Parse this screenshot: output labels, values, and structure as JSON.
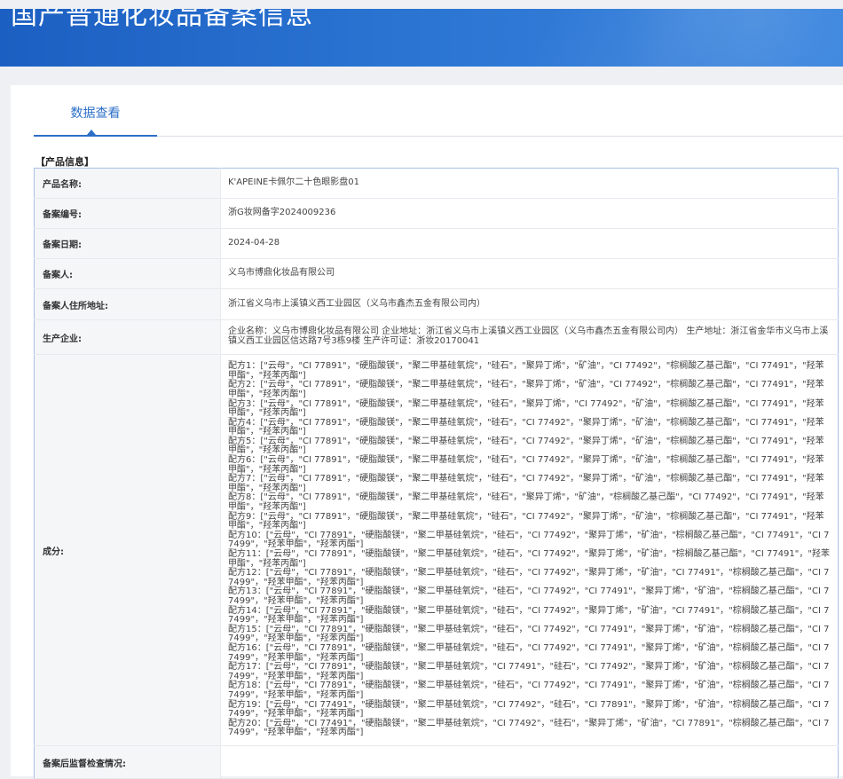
{
  "header": {
    "title": "国产普通化妆品备案信息"
  },
  "tabs": [
    {
      "label": "数据查看"
    }
  ],
  "section_title": "【产品信息】",
  "rows": {
    "product_name": {
      "label": "产品名称:",
      "value": "K'APEINE卡佩尔二十色眼影盘01"
    },
    "record_no": {
      "label": "备案编号:",
      "value": "浙G妆网备字2024009236"
    },
    "record_date": {
      "label": "备案日期:",
      "value": "2024-04-28"
    },
    "registrant": {
      "label": "备案人:",
      "value": "义乌市博鼎化妆品有限公司"
    },
    "registrant_address": {
      "label": "备案人住所地址:",
      "value": "浙江省义乌市上溪镇义西工业园区（义乌市鑫杰五金有限公司内）"
    },
    "manufacturer": {
      "label": "生产企业:",
      "value": "企业名称：义乌市博鼎化妆品有限公司 企业地址：浙江省义乌市上溪镇义西工业园区（义乌市鑫杰五金有限公司内） 生产地址：浙江省金华市义乌市上溪镇义西工业园区信达路7号3栋9楼 生产许可证：浙妆20170041"
    },
    "ingredients": {
      "label": "成分:",
      "formulas": [
        "配方1：[\"云母\"，\"CI 77891\"，\"硬脂酸镁\"，\"聚二甲基硅氧烷\"，\"硅石\"，\"聚异丁烯\"，\"矿油\"，\"CI 77492\"，\"棕榈酸乙基己酯\"，\"CI 77491\"，\"羟苯甲酯\"，\"羟苯丙酯\"]",
        "配方2：[\"云母\"，\"CI 77891\"，\"硬脂酸镁\"，\"聚二甲基硅氧烷\"，\"硅石\"，\"聚异丁烯\"，\"矿油\"，\"CI 77492\"，\"棕榈酸乙基己酯\"，\"CI 77491\"，\"羟苯甲酯\"，\"羟苯丙酯\"]",
        "配方3：[\"云母\"，\"CI 77891\"，\"硬脂酸镁\"，\"聚二甲基硅氧烷\"，\"硅石\"，\"聚异丁烯\"，\"CI 77492\"，\"矿油\"，\"棕榈酸乙基己酯\"，\"CI 77491\"，\"羟苯甲酯\"，\"羟苯丙酯\"]",
        "配方4：[\"云母\"，\"CI 77891\"，\"硬脂酸镁\"，\"聚二甲基硅氧烷\"，\"硅石\"，\"CI 77492\"，\"聚异丁烯\"，\"矿油\"，\"棕榈酸乙基己酯\"，\"CI 77491\"，\"羟苯甲酯\"，\"羟苯丙酯\"]",
        "配方5：[\"云母\"，\"CI 77891\"，\"硬脂酸镁\"，\"聚二甲基硅氧烷\"，\"硅石\"，\"CI 77492\"，\"聚异丁烯\"，\"矿油\"，\"棕榈酸乙基己酯\"，\"CI 77491\"，\"羟苯甲酯\"，\"羟苯丙酯\"]",
        "配方6：[\"云母\"，\"CI 77891\"，\"硬脂酸镁\"，\"聚二甲基硅氧烷\"，\"硅石\"，\"CI 77492\"，\"聚异丁烯\"，\"矿油\"，\"棕榈酸乙基己酯\"，\"CI 77491\"，\"羟苯甲酯\"，\"羟苯丙酯\"]",
        "配方7：[\"云母\"，\"CI 77891\"，\"硬脂酸镁\"，\"聚二甲基硅氧烷\"，\"硅石\"，\"CI 77492\"，\"聚异丁烯\"，\"矿油\"，\"棕榈酸乙基己酯\"，\"CI 77491\"，\"羟苯甲酯\"，\"羟苯丙酯\"]",
        "配方8：[\"云母\"，\"CI 77891\"，\"硬脂酸镁\"，\"聚二甲基硅氧烷\"，\"硅石\"，\"聚异丁烯\"，\"矿油\"，\"棕榈酸乙基己酯\"，\"CI 77492\"，\"CI 77491\"，\"羟苯甲酯\"，\"羟苯丙酯\"]",
        "配方9：[\"云母\"，\"CI 77891\"，\"硬脂酸镁\"，\"聚二甲基硅氧烷\"，\"硅石\"，\"CI 77492\"，\"聚异丁烯\"，\"矿油\"，\"棕榈酸乙基己酯\"，\"CI 77491\"，\"羟苯甲酯\"，\"羟苯丙酯\"]",
        "配方10：[\"云母\"，\"CI 77891\"，\"硬脂酸镁\"，\"聚二甲基硅氧烷\"，\"硅石\"，\"CI 77492\"，\"聚异丁烯\"，\"矿油\"，\"棕榈酸乙基己酯\"，\"CI 77491\"，\"CI 77499\"，\"羟苯甲酯\"，\"羟苯丙酯\"]",
        "配方11：[\"云母\"，\"CI 77891\"，\"硬脂酸镁\"，\"聚二甲基硅氧烷\"，\"硅石\"，\"CI 77492\"，\"聚异丁烯\"，\"矿油\"，\"棕榈酸乙基己酯\"，\"CI 77491\"，\"羟苯甲酯\"，\"羟苯丙酯\"]",
        "配方12：[\"云母\"，\"CI 77891\"，\"硬脂酸镁\"，\"聚二甲基硅氧烷\"，\"硅石\"，\"CI 77492\"，\"聚异丁烯\"，\"矿油\"，\"CI 77491\"，\"棕榈酸乙基己酯\"，\"CI 77499\"，\"羟苯甲酯\"，\"羟苯丙酯\"]",
        "配方13：[\"云母\"，\"CI 77891\"，\"硬脂酸镁\"，\"聚二甲基硅氧烷\"，\"硅石\"，\"CI 77492\"，\"CI 77491\"，\"聚异丁烯\"，\"矿油\"，\"棕榈酸乙基己酯\"，\"CI 77499\"，\"羟苯甲酯\"，\"羟苯丙酯\"]",
        "配方14：[\"云母\"，\"CI 77891\"，\"硬脂酸镁\"，\"聚二甲基硅氧烷\"，\"硅石\"，\"CI 77492\"，\"聚异丁烯\"，\"矿油\"，\"CI 77491\"，\"棕榈酸乙基己酯\"，\"CI 77499\"，\"羟苯甲酯\"，\"羟苯丙酯\"]",
        "配方15：[\"云母\"，\"CI 77891\"，\"硬脂酸镁\"，\"聚二甲基硅氧烷\"，\"硅石\"，\"CI 77492\"，\"CI 77491\"，\"聚异丁烯\"，\"矿油\"，\"棕榈酸乙基己酯\"，\"CI 77499\"，\"羟苯甲酯\"，\"羟苯丙酯\"]",
        "配方16：[\"云母\"，\"CI 77891\"，\"硬脂酸镁\"，\"聚二甲基硅氧烷\"，\"硅石\"，\"CI 77492\"，\"CI 77491\"，\"聚异丁烯\"，\"矿油\"，\"棕榈酸乙基己酯\"，\"CI 77499\"，\"羟苯甲酯\"，\"羟苯丙酯\"]",
        "配方17：[\"云母\"，\"CI 77891\"，\"硬脂酸镁\"，\"聚二甲基硅氧烷\"，\"CI 77491\"，\"硅石\"，\"CI 77492\"，\"聚异丁烯\"，\"矿油\"，\"棕榈酸乙基己酯\"，\"CI 77499\"，\"羟苯甲酯\"，\"羟苯丙酯\"]",
        "配方18：[\"云母\"，\"CI 77891\"，\"硬脂酸镁\"，\"聚二甲基硅氧烷\"，\"硅石\"，\"CI 77492\"，\"CI 77491\"，\"聚异丁烯\"，\"矿油\"，\"棕榈酸乙基己酯\"，\"CI 77499\"，\"羟苯甲酯\"，\"羟苯丙酯\"]",
        "配方19：[\"云母\"，\"CI 77491\"，\"硬脂酸镁\"，\"聚二甲基硅氧烷\"，\"CI 77492\"，\"硅石\"，\"CI 77891\"，\"聚异丁烯\"，\"矿油\"，\"棕榈酸乙基己酯\"，\"CI 77499\"，\"羟苯甲酯\"，\"羟苯丙酯\"]",
        "配方20：[\"云母\"，\"CI 77491\"，\"硬脂酸镁\"，\"聚二甲基硅氧烷\"，\"CI 77492\"，\"硅石\"，\"聚异丁烯\"，\"矿油\"，\"CI 77891\"，\"棕榈酸乙基己酯\"，\"CI 77499\"，\"羟苯甲酯\"，\"羟苯丙酯\"]"
      ]
    },
    "post_supervision": {
      "label": "备案后监督检查情况:",
      "value": ""
    }
  },
  "colors": {
    "header_blue": "#2a73d1",
    "tab_blue": "#2d6fc7",
    "table_border": "#a9c1e6",
    "label_bg": "#f5f6f8"
  }
}
